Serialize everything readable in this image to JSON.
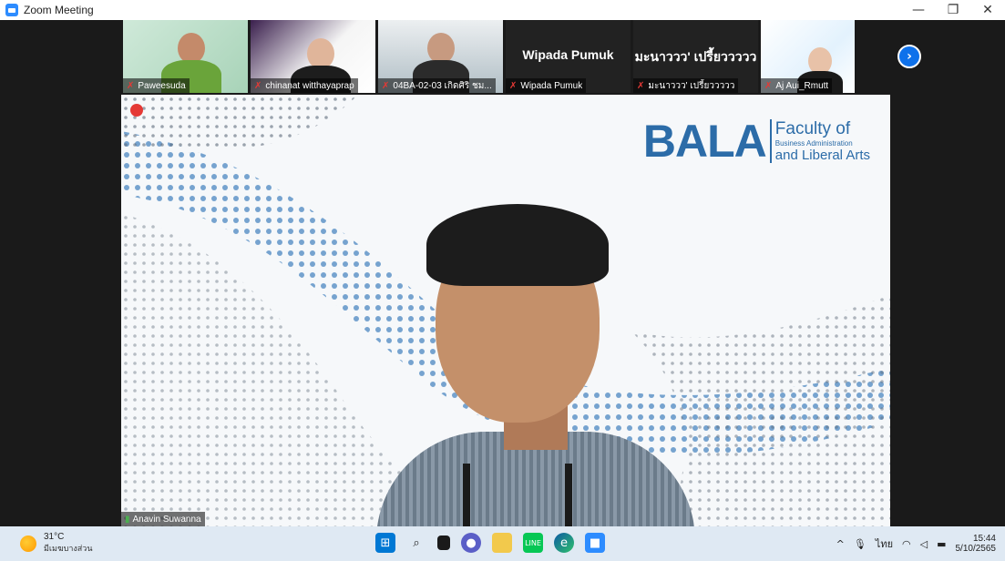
{
  "window": {
    "title": "Zoom Meeting",
    "controls": {
      "minimize": "—",
      "restore": "❐",
      "close": "✕"
    }
  },
  "participants": [
    {
      "name": "Paweesuda",
      "muted": true
    },
    {
      "name": "chinanat witthayaprap",
      "muted": true
    },
    {
      "name": "04BA-02-03 เกิดศิริ ชม...",
      "muted": true
    },
    {
      "name": "Wipada Pumuk",
      "muted": true,
      "display_name": "Wipada Pumuk"
    },
    {
      "name": "มะนาววว' เปรี้ยววววว",
      "muted": true,
      "display_name": "มะนาววว' เปรี้ยววววว"
    },
    {
      "name": "Aj Aui_Rmutt",
      "muted": true
    }
  ],
  "next_page_icon": "chevron-right-icon",
  "main_video": {
    "speaker_name": "Anavin Suwanna",
    "logo": {
      "big": "BALA",
      "line1": "Faculty of",
      "line2": "Business Administration",
      "line3": "and Liberal Arts"
    }
  },
  "taskbar": {
    "weather": {
      "temp": "31°C",
      "desc": "มีเมฆบางส่วน"
    },
    "apps": [
      "windows-start-icon",
      "search-icon",
      "task-view-icon",
      "chat-icon",
      "file-explorer-icon",
      "line-icon",
      "edge-icon",
      "zoom-icon"
    ],
    "tray": {
      "language": "ไทย",
      "time": "15:44",
      "date": "5/10/2565"
    }
  },
  "colors": {
    "zoom_blue": "#0e71eb",
    "bala_blue": "#2c6ca8",
    "muted_red": "#e53935"
  }
}
